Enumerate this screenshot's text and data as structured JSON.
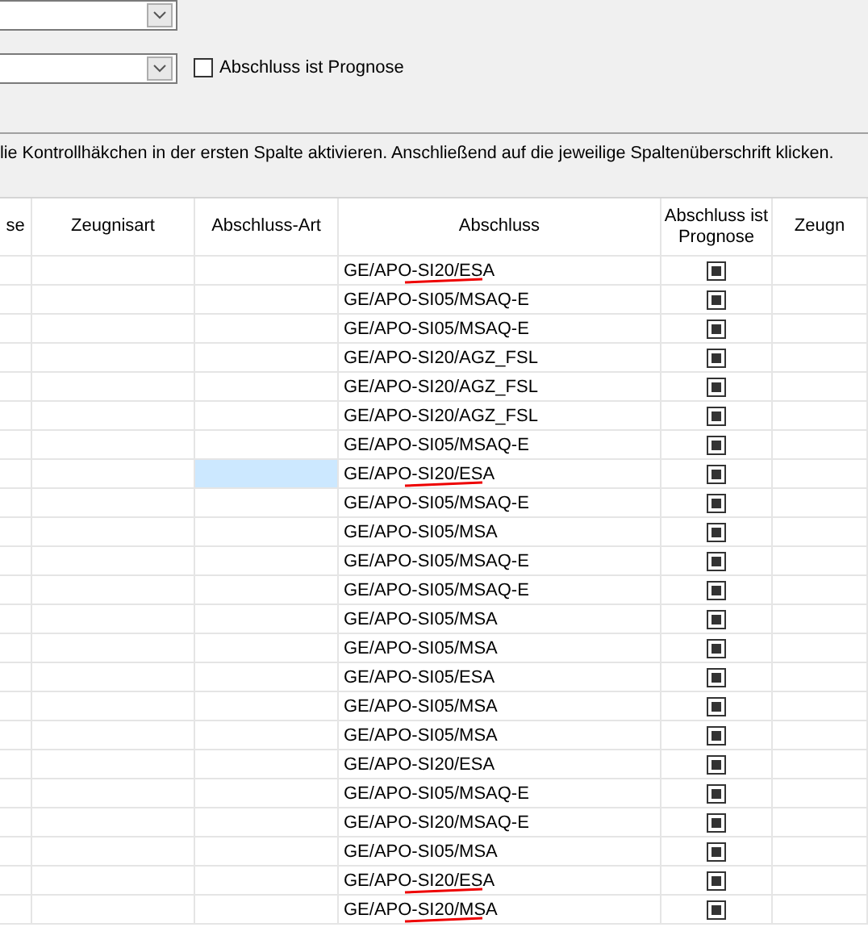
{
  "filters": [
    {
      "kind": "combo"
    },
    {
      "kind": "combo",
      "checkbox": {
        "label": "Abschluss ist Prognose",
        "checked": false
      }
    }
  ],
  "hint": "lie Kontrollhäkchen in der ersten Spalte aktivieren. Anschließend auf die jeweilige Spaltenüberschrift klicken.",
  "table": {
    "columns": [
      "se",
      "Zeugnisart",
      "Abschluss-Art",
      "Abschluss",
      "Abschluss ist Prognose",
      "Zeugn"
    ],
    "rows": [
      {
        "abschluss": "GE/APO-SI20/ESA",
        "prognose": true,
        "art_selected": false,
        "marked": true
      },
      {
        "abschluss": "GE/APO-SI05/MSAQ-E",
        "prognose": true,
        "art_selected": false,
        "marked": false
      },
      {
        "abschluss": "GE/APO-SI05/MSAQ-E",
        "prognose": true,
        "art_selected": false,
        "marked": false
      },
      {
        "abschluss": "GE/APO-SI20/AGZ_FSL",
        "prognose": true,
        "art_selected": false,
        "marked": false
      },
      {
        "abschluss": "GE/APO-SI20/AGZ_FSL",
        "prognose": true,
        "art_selected": false,
        "marked": false
      },
      {
        "abschluss": "GE/APO-SI20/AGZ_FSL",
        "prognose": true,
        "art_selected": false,
        "marked": false
      },
      {
        "abschluss": "GE/APO-SI05/MSAQ-E",
        "prognose": true,
        "art_selected": false,
        "marked": false
      },
      {
        "abschluss": "GE/APO-SI20/ESA",
        "prognose": true,
        "art_selected": true,
        "marked": true
      },
      {
        "abschluss": "GE/APO-SI05/MSAQ-E",
        "prognose": true,
        "art_selected": false,
        "marked": false
      },
      {
        "abschluss": "GE/APO-SI05/MSA",
        "prognose": true,
        "art_selected": false,
        "marked": false
      },
      {
        "abschluss": "GE/APO-SI05/MSAQ-E",
        "prognose": true,
        "art_selected": false,
        "marked": false
      },
      {
        "abschluss": "GE/APO-SI05/MSAQ-E",
        "prognose": true,
        "art_selected": false,
        "marked": false
      },
      {
        "abschluss": "GE/APO-SI05/MSA",
        "prognose": true,
        "art_selected": false,
        "marked": false
      },
      {
        "abschluss": "GE/APO-SI05/MSA",
        "prognose": true,
        "art_selected": false,
        "marked": false
      },
      {
        "abschluss": "GE/APO-SI05/ESA",
        "prognose": true,
        "art_selected": false,
        "marked": false
      },
      {
        "abschluss": "GE/APO-SI05/MSA",
        "prognose": true,
        "art_selected": false,
        "marked": false
      },
      {
        "abschluss": "GE/APO-SI05/MSA",
        "prognose": true,
        "art_selected": false,
        "marked": false
      },
      {
        "abschluss": "GE/APO-SI20/ESA",
        "prognose": true,
        "art_selected": false,
        "marked": false
      },
      {
        "abschluss": "GE/APO-SI05/MSAQ-E",
        "prognose": true,
        "art_selected": false,
        "marked": false
      },
      {
        "abschluss": "GE/APO-SI20/MSAQ-E",
        "prognose": true,
        "art_selected": false,
        "marked": false
      },
      {
        "abschluss": "GE/APO-SI05/MSA",
        "prognose": true,
        "art_selected": false,
        "marked": false
      },
      {
        "abschluss": "GE/APO-SI20/ESA",
        "prognose": true,
        "art_selected": false,
        "marked": true
      },
      {
        "abschluss": "GE/APO-SI20/MSA",
        "prognose": true,
        "art_selected": false,
        "marked": true
      }
    ]
  }
}
